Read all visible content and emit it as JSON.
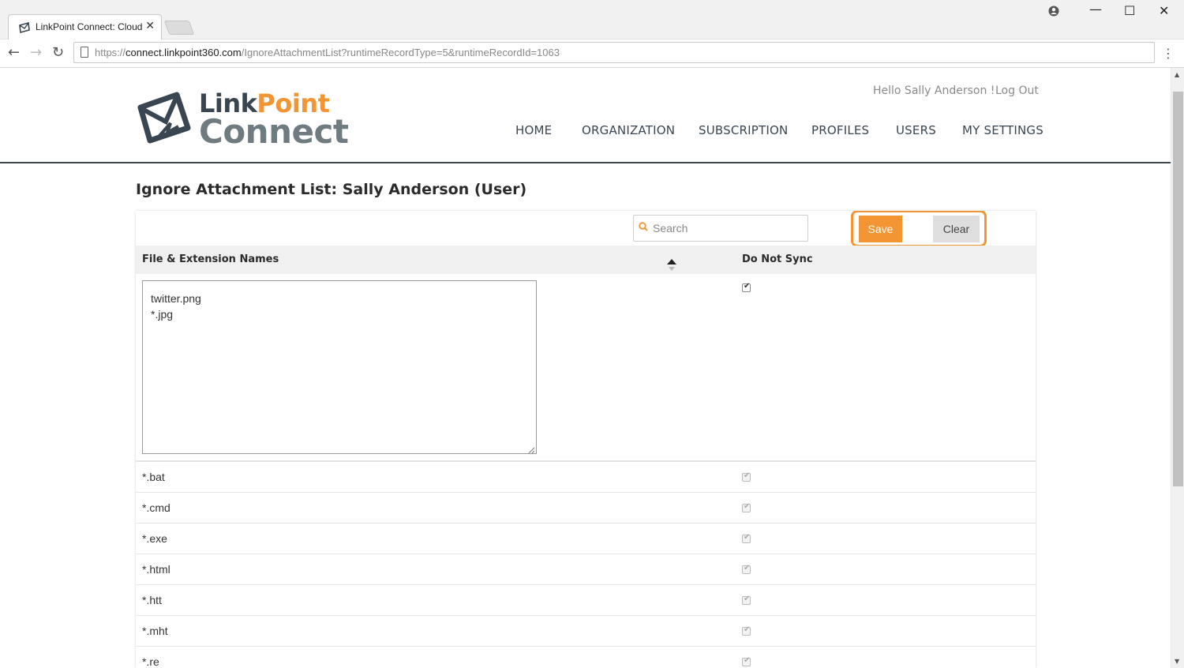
{
  "browser": {
    "tab_title": "LinkPoint Connect: Cloud",
    "url_scheme": "https://",
    "url_host": "connect.linkpoint360.com",
    "url_path": "/IgnoreAttachmentList?runtimeRecordType=5&runtimeRecordId=1063"
  },
  "header": {
    "logo_part1": "Link",
    "logo_part2": "Point",
    "logo_part3": "Connect",
    "greeting": "Hello Sally Anderson !",
    "logout": "Log Out",
    "nav": [
      "HOME",
      "ORGANIZATION",
      "SUBSCRIPTION",
      "PROFILES",
      "USERS",
      "MY SETTINGS"
    ]
  },
  "page": {
    "title": "Ignore Attachment List: Sally Anderson (User)"
  },
  "toolbar": {
    "search_placeholder": "Search",
    "save_label": "Save",
    "clear_label": "Clear"
  },
  "table": {
    "col_names": "File & Extension Names",
    "col_sync": "Do Not Sync",
    "edit_value": "twitter.png\n*.jpg",
    "edit_checked": true,
    "rows": [
      {
        "name": "*.bat",
        "checked": true
      },
      {
        "name": "*.cmd",
        "checked": true
      },
      {
        "name": "*.exe",
        "checked": true
      },
      {
        "name": "*.html",
        "checked": true
      },
      {
        "name": "*.htt",
        "checked": true
      },
      {
        "name": "*.mht",
        "checked": true
      },
      {
        "name": "*.re",
        "checked": true
      }
    ]
  },
  "colors": {
    "accent": "#f29532",
    "dark": "#394652",
    "grey": "#6e7c82"
  }
}
